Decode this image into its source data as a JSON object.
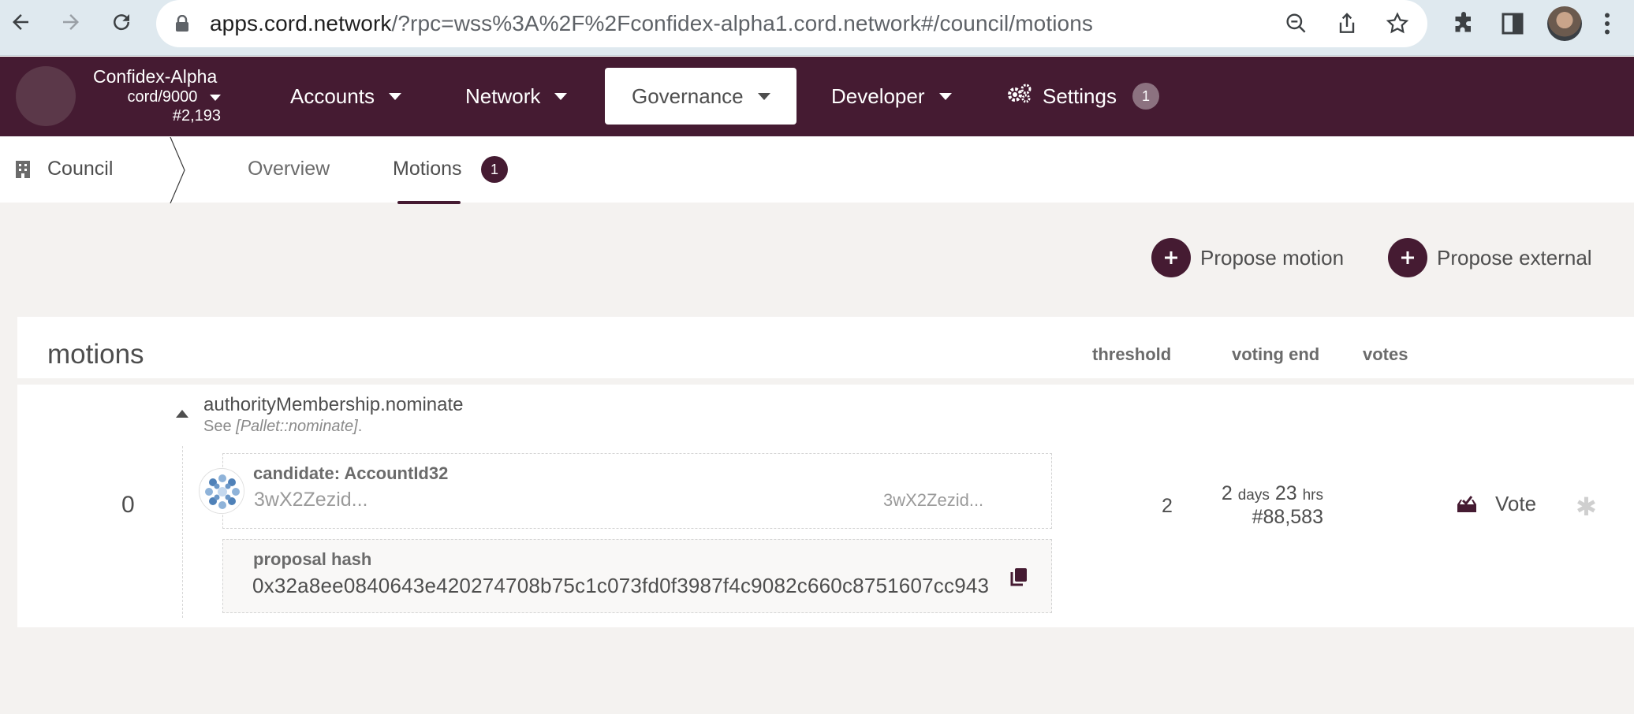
{
  "browser": {
    "url_host": "apps.cord.network",
    "url_rest": "/?rpc=wss%3A%2F%2Fconfidex-alpha1.cord.network#/council/motions"
  },
  "chain": {
    "name": "Confidex-Alpha",
    "spec": "cord/9000",
    "block": "#2,193"
  },
  "menu": {
    "accounts": "Accounts",
    "network": "Network",
    "governance": "Governance",
    "developer": "Developer",
    "settings": "Settings",
    "settings_badge": "1"
  },
  "colors": {
    "brand": "#451b32",
    "badge_gray": "#8c7280"
  },
  "subnav": {
    "section": "Council",
    "tabs": [
      {
        "label": "Overview"
      },
      {
        "label": "Motions",
        "badge": "1"
      }
    ]
  },
  "actions": {
    "propose_motion": "Propose motion",
    "propose_external": "Propose external"
  },
  "table": {
    "title": "motions",
    "headers": {
      "threshold": "threshold",
      "voting_end": "voting end",
      "votes": "votes"
    },
    "rows": [
      {
        "index": "0",
        "call": "authorityMembership.nominate",
        "doc_prefix": "See ",
        "doc_italic": "[Pallet::nominate]",
        "doc_suffix": ".",
        "candidate_label": "candidate: AccountId32",
        "candidate_address": "3wX2Zezid...",
        "candidate_address_short": "3wX2Zezid...",
        "hash_label": "proposal hash",
        "hash_value": "0x32a8ee0840643e420274708b75c1c073fd0f3987f4c9082c660c8751607cc943",
        "threshold": "2",
        "voting_end_days": "2",
        "voting_end_days_unit": "days",
        "voting_end_hrs": "23",
        "voting_end_hrs_unit": "hrs",
        "voting_end_block": "#88,583",
        "vote_label": "Vote"
      }
    ]
  }
}
